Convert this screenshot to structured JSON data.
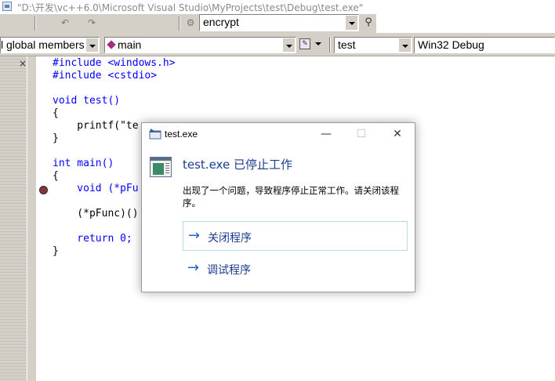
{
  "window": {
    "title": "\"D:\\开发\\vc++6.0\\Microsoft Visual Studio\\MyProjects\\test\\Debug\\test.exe\""
  },
  "toolbar1": {
    "combo_value": "encrypt",
    "icons": [
      "undo-icon",
      "redo-icon",
      "build-icon",
      "find-in-files-icon"
    ]
  },
  "toolbar2": {
    "class_combo": "l global members",
    "member_combo": "main",
    "project_combo": "test",
    "config_combo": "Win32 Debug"
  },
  "left_pane": {
    "close_glyph": "×"
  },
  "editor": {
    "lines": [
      "#include <windows.h>",
      "#include <cstdio>",
      "",
      "void test()",
      "{",
      "    printf(\"te",
      "}",
      "",
      "int main()",
      "{",
      "    void (*pFu",
      "",
      "    (*pFunc)()",
      "",
      "    return 0;",
      "}"
    ]
  },
  "dialog": {
    "title": "test.exe",
    "heading": "test.exe 已停止工作",
    "message": "出现了一个问题，导致程序停止正常工作。请关闭该程序。",
    "actions": [
      {
        "label": "关闭程序",
        "arrow": "→"
      },
      {
        "label": "调试程序",
        "arrow": "→"
      }
    ],
    "minimize_glyph": "—",
    "maximize_glyph": "☐",
    "close_glyph": "✕"
  },
  "colors": {
    "keyword": "#0000ff",
    "link": "#1b3d8f",
    "ide_chrome": "#d4d0c8"
  }
}
